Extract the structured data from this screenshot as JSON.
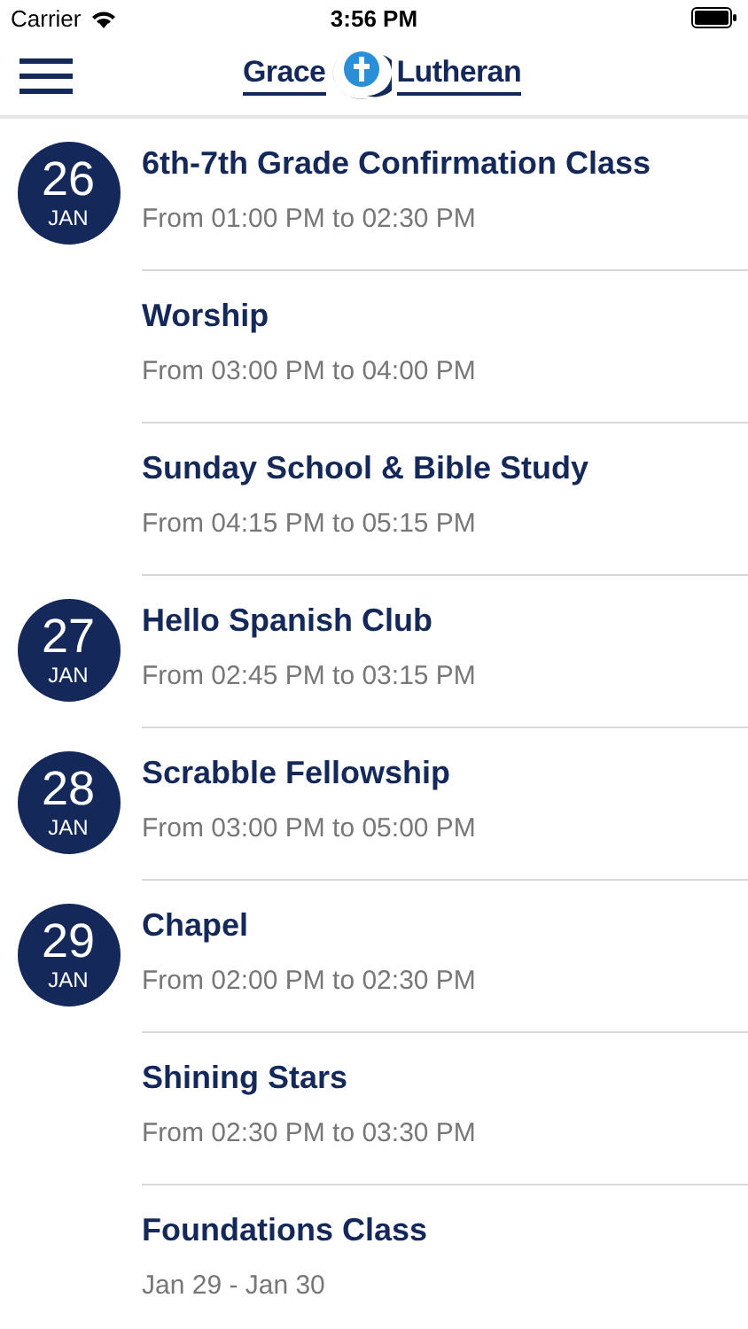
{
  "status_bar": {
    "carrier": "Carrier",
    "time": "3:56 PM"
  },
  "nav": {
    "logo_left": "Grace",
    "logo_right": "Lutheran"
  },
  "events": [
    {
      "date": {
        "day": "26",
        "month": "JAN"
      },
      "title": "6th-7th Grade Confirmation Class",
      "time": "From 01:00 PM to 02:30 PM"
    },
    {
      "title": "Worship",
      "time": "From 03:00 PM to 04:00 PM"
    },
    {
      "title": "Sunday School & Bible Study",
      "time": "From 04:15 PM to 05:15 PM"
    },
    {
      "date": {
        "day": "27",
        "month": "JAN"
      },
      "title": "Hello Spanish Club",
      "time": "From 02:45 PM to 03:15 PM"
    },
    {
      "date": {
        "day": "28",
        "month": "JAN"
      },
      "title": "Scrabble Fellowship",
      "time": "From 03:00 PM to 05:00 PM"
    },
    {
      "date": {
        "day": "29",
        "month": "JAN"
      },
      "title": "Chapel",
      "time": "From 02:00 PM to 02:30 PM"
    },
    {
      "title": "Shining Stars",
      "time": "From 02:30 PM to 03:30 PM"
    },
    {
      "title": "Foundations Class",
      "time": "Jan 29 - Jan 30"
    }
  ]
}
